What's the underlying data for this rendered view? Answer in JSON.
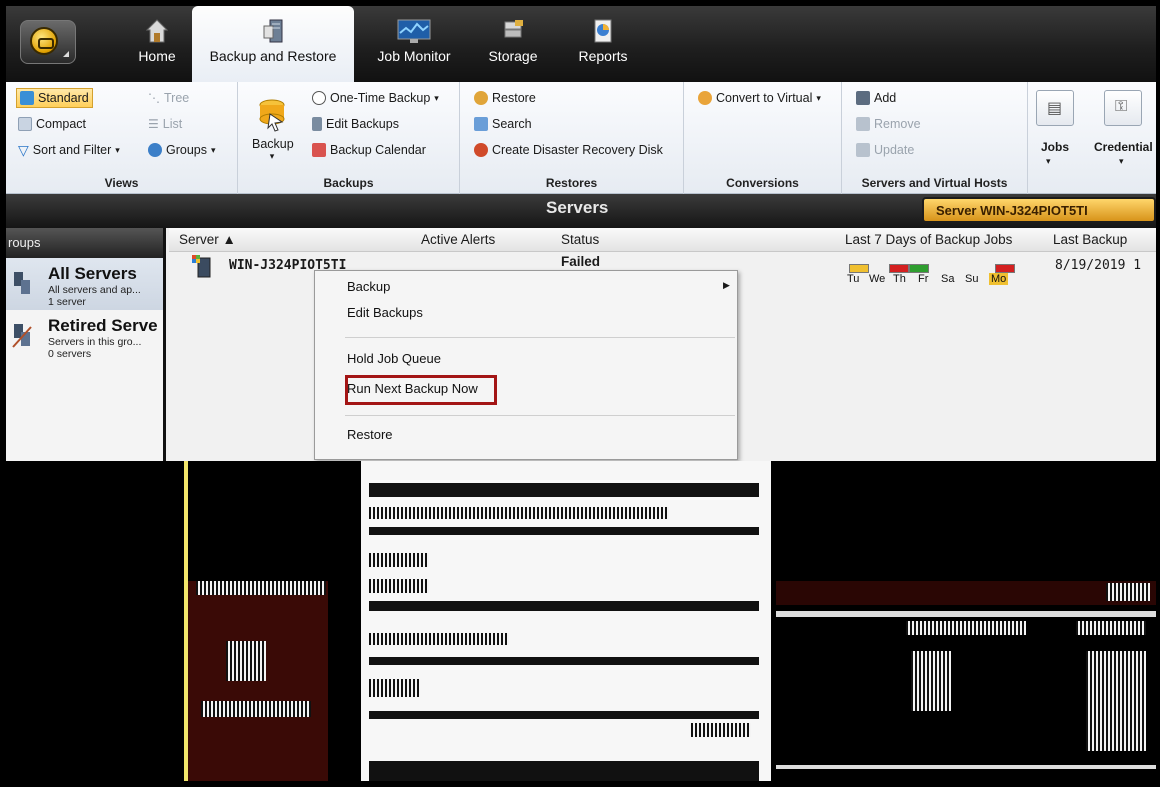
{
  "tabs": [
    {
      "label": "Home",
      "icon": "home-icon",
      "active": false
    },
    {
      "label": "Backup and Restore",
      "icon": "backup-restore-icon",
      "active": true
    },
    {
      "label": "Job Monitor",
      "icon": "job-monitor-icon",
      "active": false
    },
    {
      "label": "Storage",
      "icon": "storage-icon",
      "active": false
    },
    {
      "label": "Reports",
      "icon": "reports-icon",
      "active": false
    }
  ],
  "ribbon": {
    "views": {
      "title": "Views",
      "standard": "Standard",
      "compact": "Compact",
      "sort_filter": "Sort and Filter",
      "tree": "Tree",
      "list": "List",
      "groups": "Groups"
    },
    "backups": {
      "title": "Backups",
      "backup": "Backup",
      "one_time_backup": "One-Time Backup",
      "edit_backups": "Edit Backups",
      "backup_calendar": "Backup Calendar"
    },
    "restores": {
      "title": "Restores",
      "restore": "Restore",
      "search": "Search",
      "create_dr_disk": "Create Disaster Recovery Disk"
    },
    "conversions": {
      "title": "Conversions",
      "convert_to_virtual": "Convert to Virtual"
    },
    "servers_vhosts": {
      "title": "Servers and Virtual Hosts",
      "add": "Add",
      "remove": "Remove",
      "update": "Update"
    },
    "jobs": "Jobs",
    "credentials": "Credential"
  },
  "band": {
    "title": "Servers",
    "server_pill": "Server WIN-J324PIOT5TI"
  },
  "groups": {
    "header": "roups",
    "items": [
      {
        "title": "All Servers",
        "sub": "All servers and ap...",
        "count": "1 server"
      },
      {
        "title": "Retired Serve",
        "sub": "Servers in this gro...",
        "count": "0 servers"
      }
    ]
  },
  "grid": {
    "columns": [
      "Server ▲",
      "Active Alerts",
      "Status",
      "Last 7 Days of Backup Jobs",
      "Last Backup"
    ],
    "rows": [
      {
        "server": "WIN-J324PIOT5TI",
        "status": "Failed",
        "last_backup": "8/19/2019 1"
      }
    ],
    "days": [
      "Tu",
      "We",
      "Th",
      "Fr",
      "Sa",
      "Su",
      "Mo"
    ]
  },
  "context_menu": {
    "items": [
      "Backup",
      "Edit Backups",
      "Hold Job Queue",
      "Run Next Backup Now",
      "Restore"
    ],
    "highlighted": "Run Next Backup Now"
  },
  "colors": {
    "accent_orange": "#e0a000",
    "highlight_red": "#a31515",
    "failed_red": "#d42020",
    "success_green": "#2f9e2f",
    "warning_yellow": "#f0c030"
  }
}
